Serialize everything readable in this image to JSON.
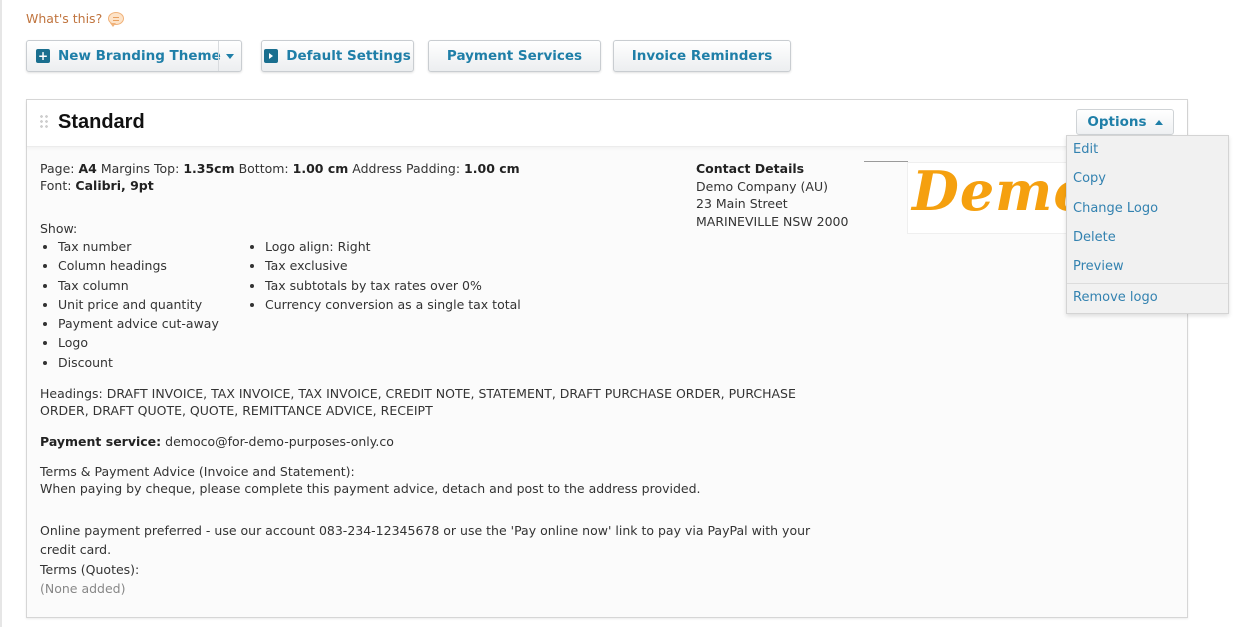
{
  "help": {
    "label": "What's this?",
    "icon": "speech-bubble-icon"
  },
  "toolbar": {
    "new_theme_label": "New Branding Theme",
    "default_settings_label": "Default Settings",
    "payment_services_label": "Payment Services",
    "invoice_reminders_label": "Invoice Reminders"
  },
  "theme": {
    "title": "Standard",
    "options_label": "Options",
    "specs": {
      "page_label": "Page:",
      "page_value": "A4",
      "margins_top_label": "Margins Top:",
      "margins_top_value": "1.35cm",
      "bottom_label": "Bottom:",
      "bottom_value": "1.00 cm",
      "address_padding_label": "Address Padding:",
      "address_padding_value": "1.00 cm",
      "font_label": "Font:",
      "font_value": "Calibri, 9pt"
    },
    "show_label": "Show:",
    "show_col1": [
      "Tax number",
      "Column headings",
      "Tax column",
      "Unit price and quantity",
      "Payment advice cut-away",
      "Logo",
      "Discount"
    ],
    "show_col2": [
      "Logo align: Right",
      "Tax exclusive",
      "Tax subtotals by tax rates over 0%",
      "Currency conversion as a single tax total"
    ],
    "headings": "Headings: DRAFT INVOICE, TAX INVOICE, TAX INVOICE, CREDIT NOTE, STATEMENT, DRAFT PURCHASE ORDER, PURCHASE ORDER, DRAFT QUOTE, QUOTE, REMITTANCE ADVICE, RECEIPT",
    "payment_service_label": "Payment service:",
    "payment_service_value": "democo@for-demo-purposes-only.co",
    "terms_label": "Terms & Payment Advice (Invoice and Statement):",
    "terms_text": "When paying by cheque, please complete this payment advice, detach and post to the address provided.",
    "online_text": "Online payment preferred - use our account 083-234-12345678 or use the 'Pay online now' link to pay via PayPal with your credit card.",
    "quotes_label": "Terms (Quotes):",
    "quotes_value": "(None added)",
    "contact": {
      "heading": "Contact Details",
      "lines": [
        "Demo Company (AU)",
        "23 Main Street",
        "MARINEVILLE NSW 2000"
      ]
    },
    "logo_text": "Demo"
  },
  "options_menu": {
    "items": [
      "Edit",
      "Copy",
      "Change Logo",
      "Delete",
      "Preview",
      "Remove logo"
    ]
  },
  "colors": {
    "accent": "#1f7fa8",
    "logo": "#f5a00f",
    "help_link": "#c0743e"
  }
}
